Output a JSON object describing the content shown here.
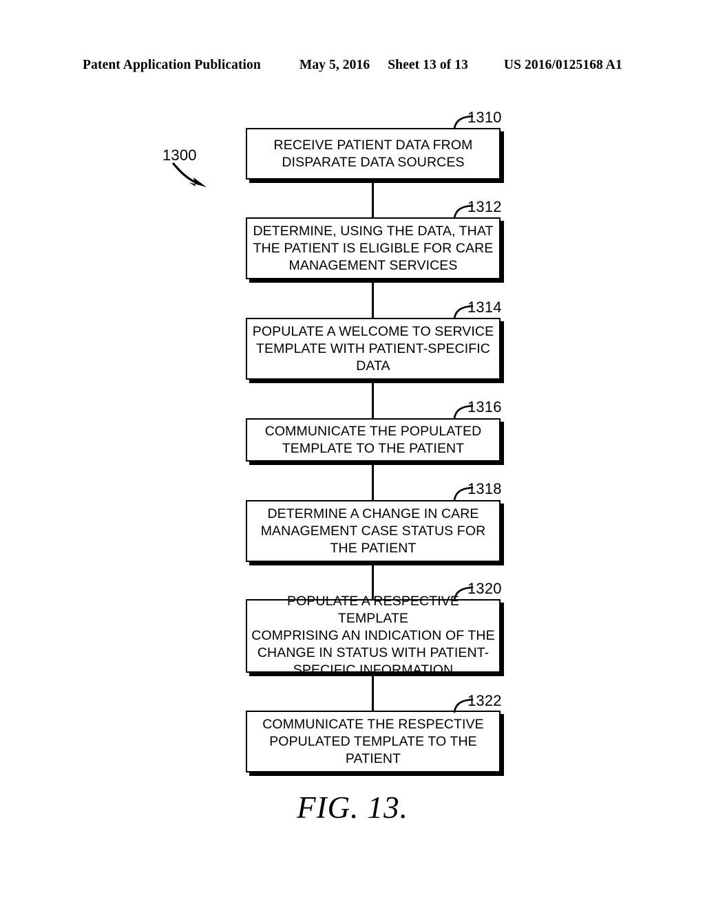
{
  "header": {
    "publication": "Patent Application Publication",
    "date": "May 5, 2016",
    "sheet": "Sheet 13 of 13",
    "patent_number": "US 2016/0125168 A1"
  },
  "figure": {
    "caption": "FIG.  13.",
    "diagram_label": "1300",
    "type": "flowchart"
  },
  "flow": {
    "steps": [
      {
        "ref": "1310",
        "text": "RECEIVE PATIENT DATA FROM\nDISPARATE DATA SOURCES"
      },
      {
        "ref": "1312",
        "text": "DETERMINE, USING THE DATA, THAT\nTHE PATIENT IS ELIGIBLE FOR CARE\nMANAGEMENT SERVICES"
      },
      {
        "ref": "1314",
        "text": "POPULATE A WELCOME TO SERVICE\nTEMPLATE WITH PATIENT-SPECIFIC\nDATA"
      },
      {
        "ref": "1316",
        "text": "COMMUNICATE THE POPULATED\nTEMPLATE TO THE PATIENT"
      },
      {
        "ref": "1318",
        "text": "DETERMINE A CHANGE IN CARE\nMANAGEMENT CASE STATUS FOR\nTHE PATIENT"
      },
      {
        "ref": "1320",
        "text": "POPULATE A RESPECTIVE TEMPLATE\nCOMPRISING AN INDICATION OF THE\nCHANGE IN STATUS WITH PATIENT-\nSPECIFIC INFORMATION"
      },
      {
        "ref": "1322",
        "text": "COMMUNICATE THE RESPECTIVE\nPOPULATED TEMPLATE TO THE\nPATIENT"
      }
    ]
  },
  "colors": {
    "ink": "#000000",
    "paper": "#ffffff"
  }
}
